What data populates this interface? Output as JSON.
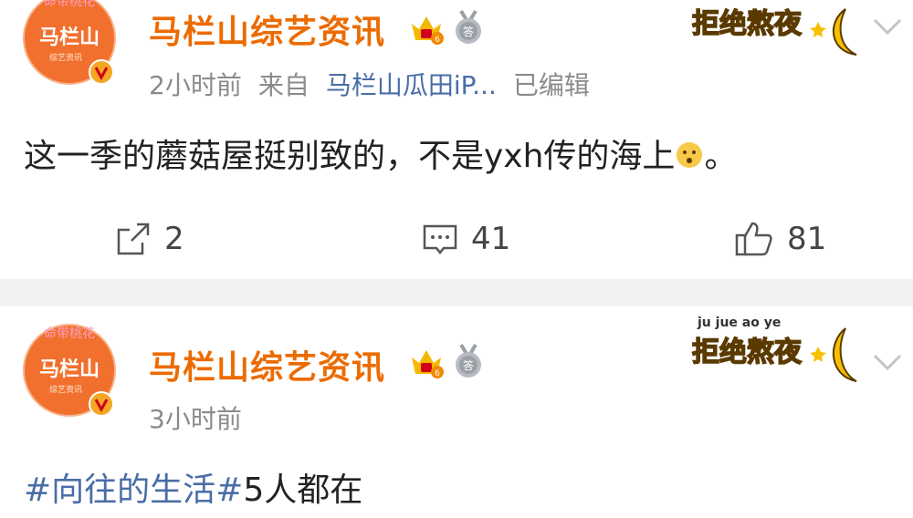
{
  "posts": [
    {
      "username": "马栏山综艺资讯",
      "avatar_text": "马栏山",
      "avatar_arc_text": "命带桃花",
      "avatar_sub_text": "综艺资讯",
      "time": "2小时前",
      "source_prefix": "来自",
      "source": "马栏山瓜田iP...",
      "edited": "已编辑",
      "content": "这一季的蘑菇屋挺别致的，不是yxh传的海上",
      "content_tail": "。",
      "deco_text": "拒绝熬夜",
      "actions": {
        "repost": "2",
        "comment": "41",
        "like": "81"
      }
    },
    {
      "username": "马栏山综艺资讯",
      "avatar_text": "马栏山",
      "avatar_arc_text": "命带桃花",
      "avatar_sub_text": "综艺资讯",
      "time": "3小时前",
      "topic": "#向往的生活#",
      "content": "5人都在",
      "deco_text": "拒绝熬夜",
      "deco_pinyin": "ju jue ao ye"
    }
  ],
  "icons": [
    "crown-icon",
    "medal-icon",
    "chevron-down-icon",
    "repost-icon",
    "comment-icon",
    "like-icon",
    "thinking-emoji-icon",
    "moon-icon"
  ],
  "colors": {
    "username": "#ec6b00",
    "link": "#4a6da7",
    "meta": "#8b8b8b",
    "avatar_bg": "#f2702d",
    "divider": "#f2f2f2"
  }
}
